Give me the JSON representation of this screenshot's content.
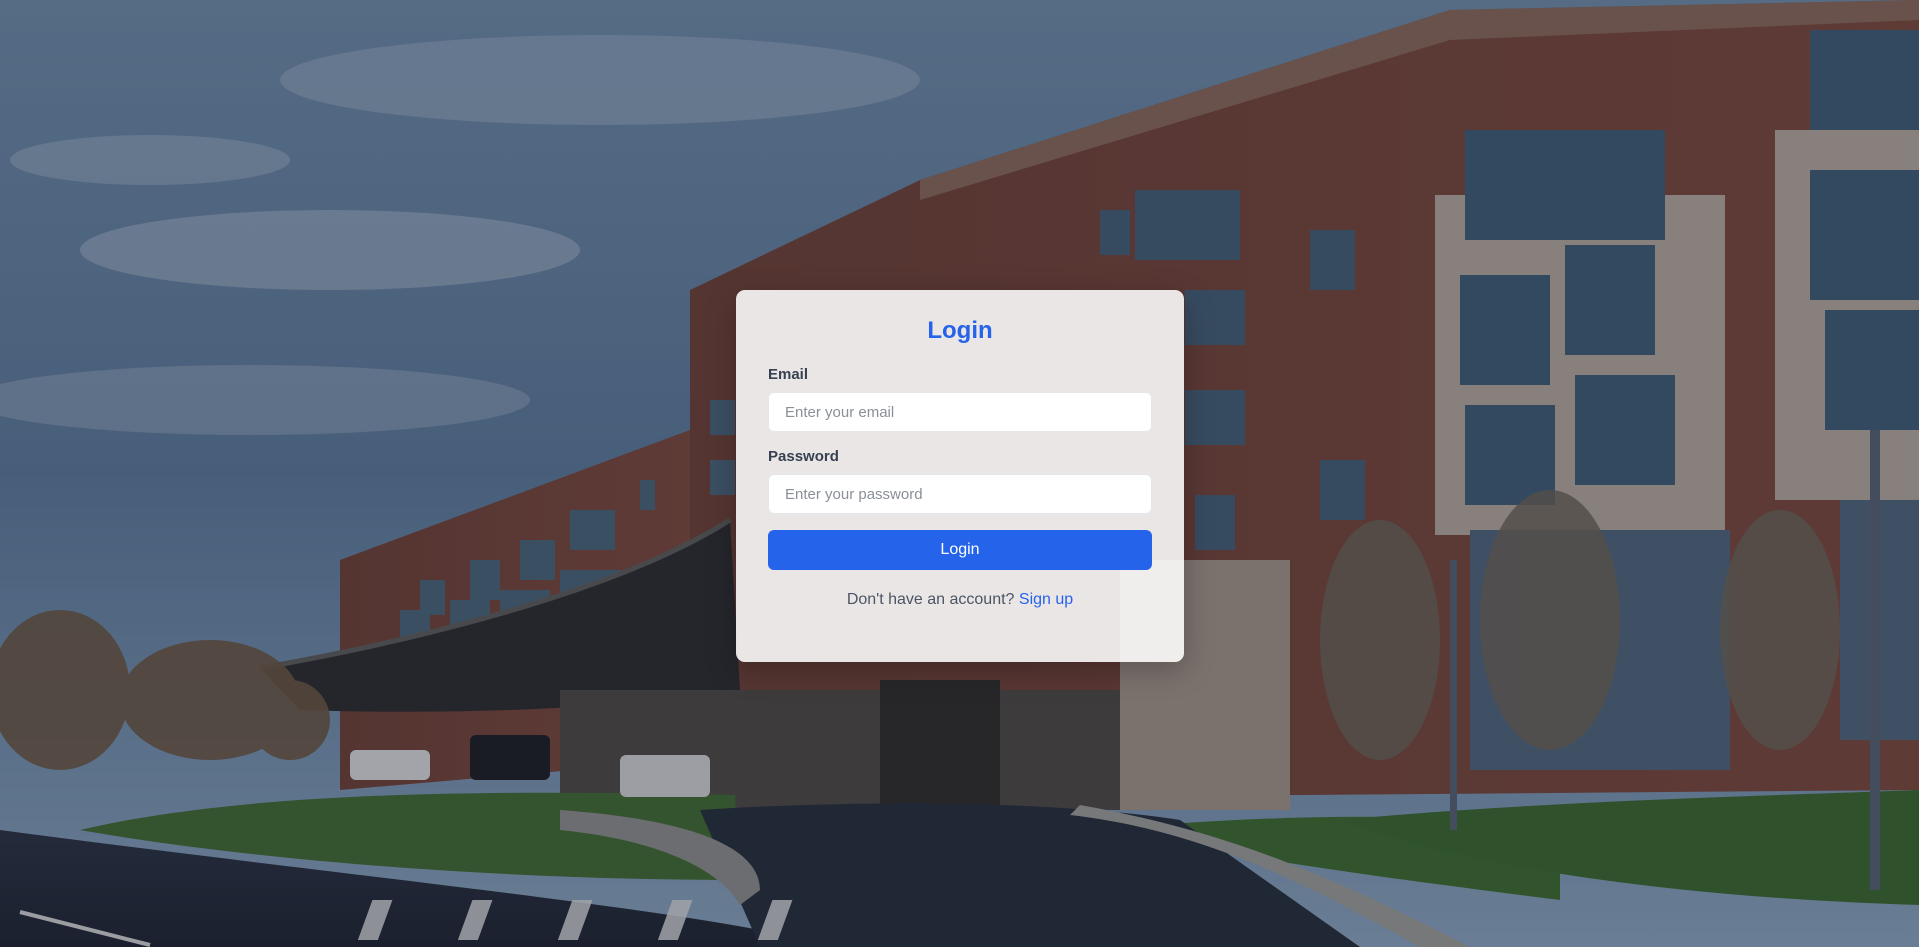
{
  "login": {
    "title": "Login",
    "email_label": "Email",
    "email_placeholder": "Enter your email",
    "email_value": "",
    "password_label": "Password",
    "password_placeholder": "Enter your password",
    "password_value": "",
    "submit_label": "Login",
    "signup_prompt": "Don't have an account?",
    "signup_link": "Sign up"
  },
  "colors": {
    "accent": "#2563eb",
    "card_background": "#ffffff",
    "label_text": "#374151"
  }
}
